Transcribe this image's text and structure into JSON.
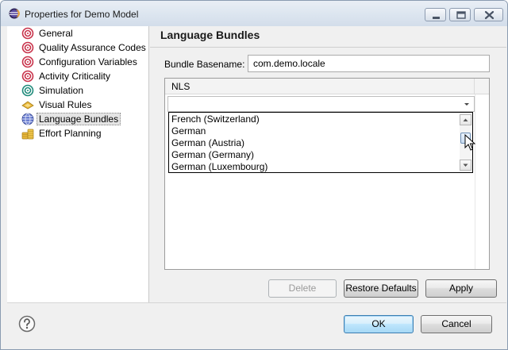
{
  "window": {
    "title": "Properties for Demo Model"
  },
  "tree": {
    "items": [
      {
        "label": "General",
        "icon": "spiral-icon",
        "color": "#c8324a"
      },
      {
        "label": "Quality Assurance Codes",
        "icon": "spiral-icon",
        "color": "#c8324a"
      },
      {
        "label": "Configuration Variables",
        "icon": "spiral-icon",
        "color": "#c8324a"
      },
      {
        "label": "Activity Criticality",
        "icon": "spiral-icon",
        "color": "#c8324a"
      },
      {
        "label": "Simulation",
        "icon": "spiral-icon",
        "color": "#1f8a7a"
      },
      {
        "label": "Visual Rules",
        "icon": "rules-icon",
        "color": "#d8a21a"
      },
      {
        "label": "Language Bundles",
        "icon": "globe-icon",
        "color": "#3d5aa8",
        "selected": true
      },
      {
        "label": "Effort Planning",
        "icon": "coins-icon",
        "color": "#d8a21a"
      }
    ]
  },
  "panel": {
    "title": "Language Bundles",
    "bundle_basename_label": "Bundle Basename:",
    "bundle_basename_value": "com.demo.locale",
    "table": {
      "column_nls": "NLS",
      "combo_value": "",
      "dropdown_options": [
        "French (Switzerland)",
        "German",
        "German (Austria)",
        "German (Germany)",
        "German (Luxembourg)"
      ]
    },
    "buttons": {
      "delete": "Delete",
      "restore_defaults": "Restore Defaults",
      "apply": "Apply"
    }
  },
  "footer": {
    "ok": "OK",
    "cancel": "Cancel"
  }
}
